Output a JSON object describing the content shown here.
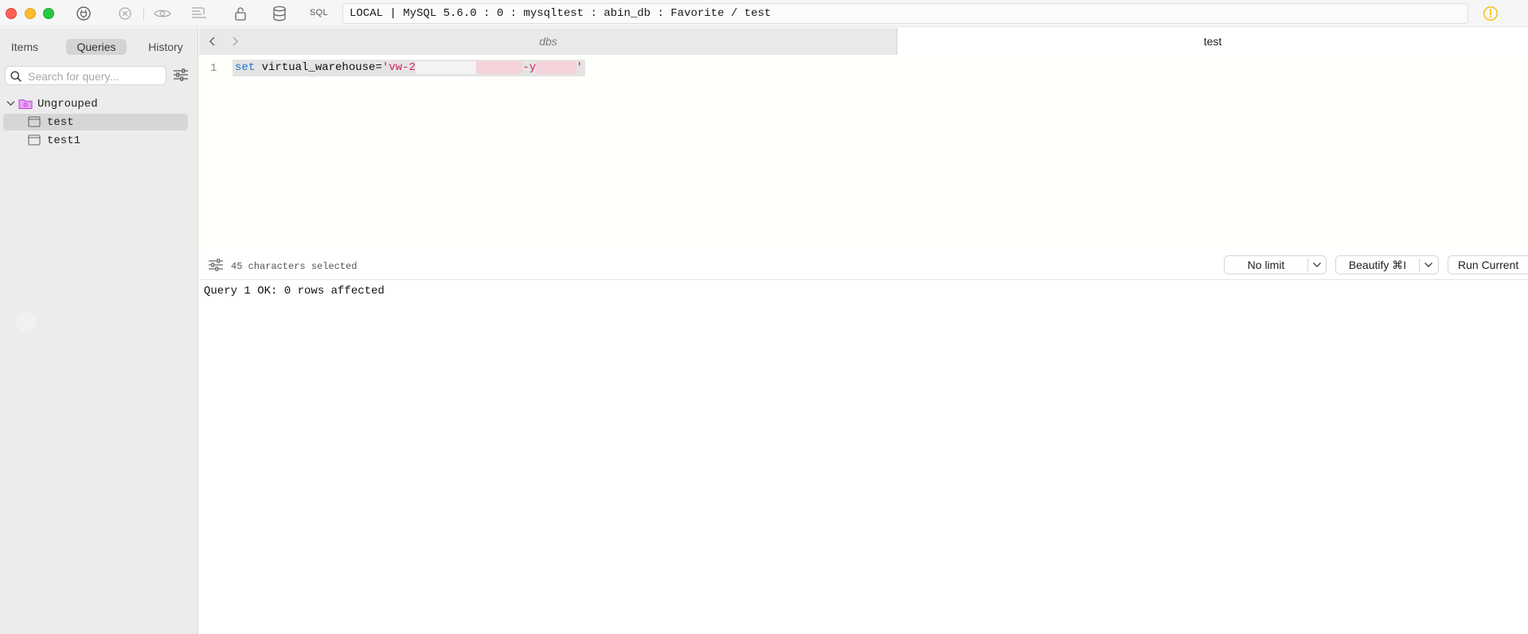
{
  "toolbar": {
    "sql_label": "SQL",
    "connection": "LOCAL | MySQL 5.6.0 : 0 : mysqltest : abin_db : Favorite / test",
    "icons": [
      "connection-icon",
      "stop-icon",
      "preview-icon",
      "format-icon",
      "lock-icon",
      "database-icon",
      "warning-icon"
    ]
  },
  "sidebar": {
    "tabs": {
      "items": "Items",
      "queries": "Queries",
      "history": "History"
    },
    "active_tab": "Queries",
    "search_placeholder": "Search for query...",
    "group": {
      "label": "Ungrouped",
      "expanded": true
    },
    "queries": [
      {
        "label": "test",
        "selected": true
      },
      {
        "label": "test1",
        "selected": false
      }
    ]
  },
  "tabs": [
    {
      "label": "dbs",
      "active": false
    },
    {
      "label": "test",
      "active": true
    }
  ],
  "editor": {
    "line_number": "1",
    "code": {
      "keyword": "set",
      "ident": " virtual_warehouse=",
      "str_open": "'vw-2",
      "str_mid": "-y",
      "str_close": "'"
    }
  },
  "status": {
    "selection": "45 characters selected",
    "limit_label": "No limit",
    "beautify_label": "Beautify ⌘I",
    "run_label": "Run Current"
  },
  "results": {
    "message": "Query 1 OK: 0 rows affected"
  },
  "colors": {
    "keyword": "#1d6fc9",
    "string": "#d4215c",
    "warning": "#f5c518",
    "folder": "#c23fd8"
  }
}
